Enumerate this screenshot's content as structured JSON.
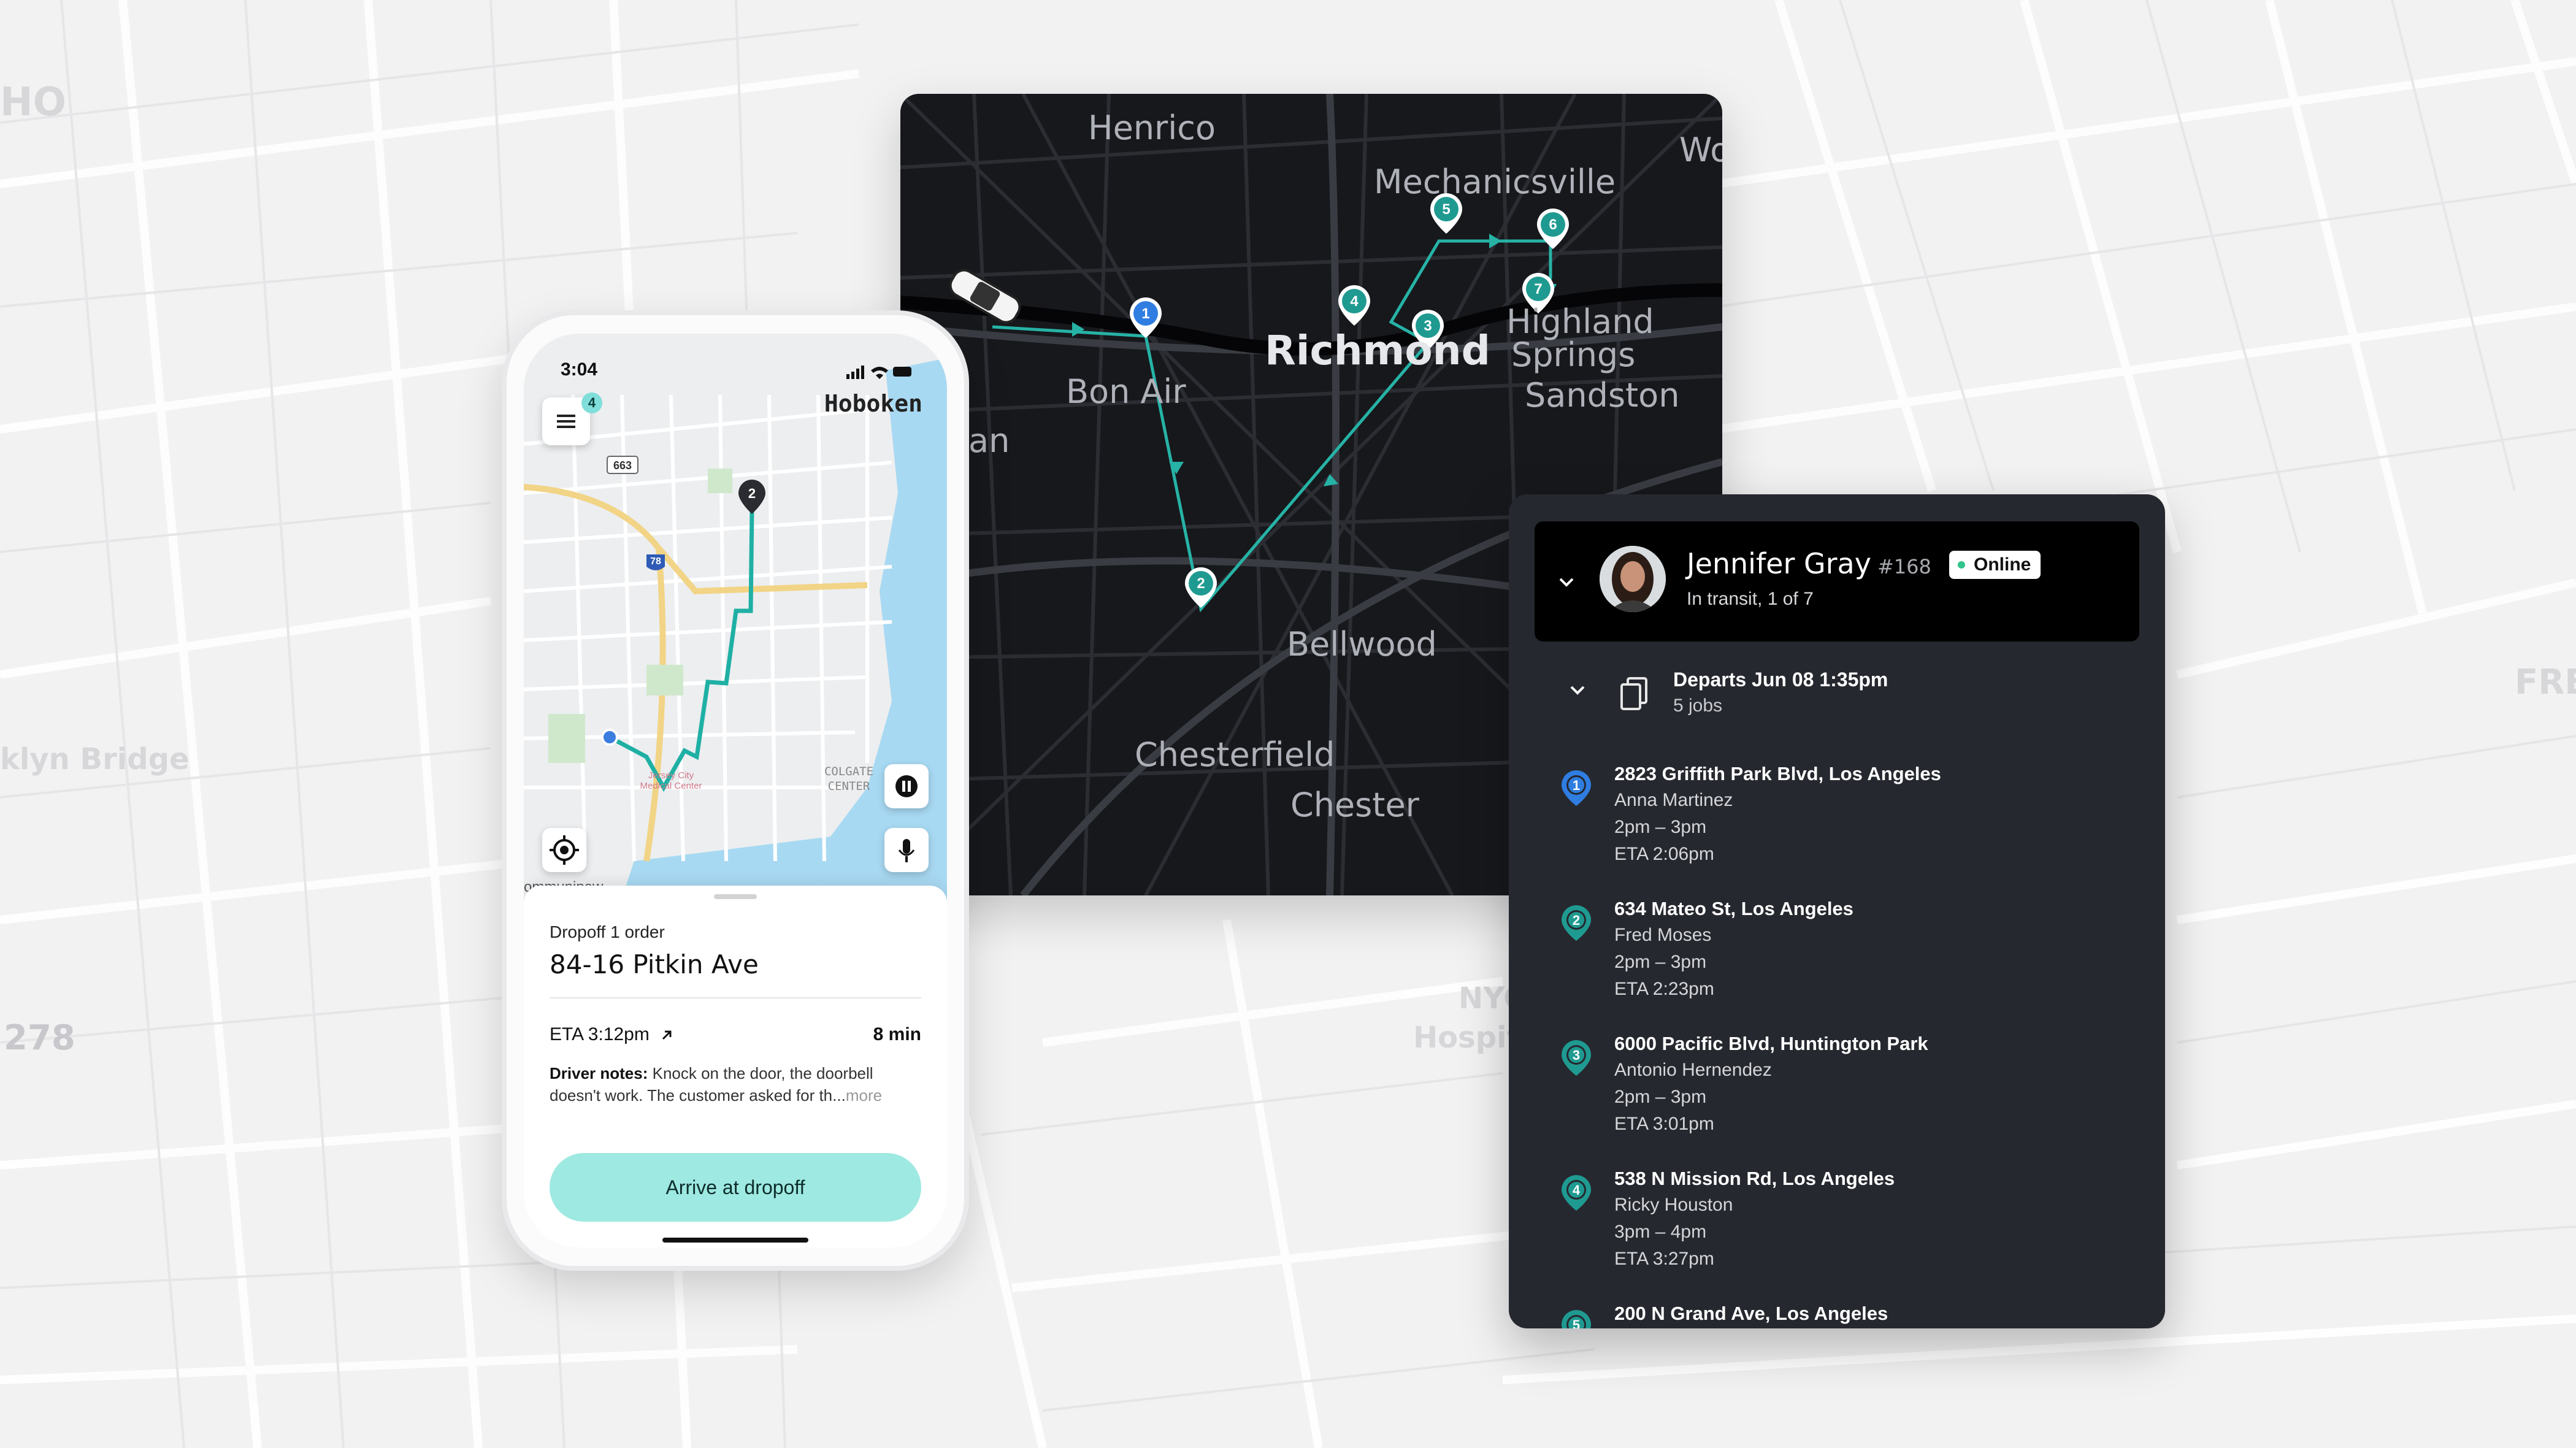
{
  "background": {
    "labels": [
      "HO",
      "klyn Bridge",
      "278",
      "FRE",
      "NYC",
      "Hospita"
    ]
  },
  "dark_map": {
    "labels": {
      "henrico": "Henrico",
      "mechanicsville": "Mechanicsville",
      "wo": "Wo",
      "richmond": "Richmond",
      "highland": "Highland",
      "springs": "Springs",
      "sandston": "Sandston",
      "bon_air": "Bon Air",
      "ian": "ian",
      "bellwood": "Bellwood",
      "chesterfield": "Chesterfield",
      "chester": "Chester"
    },
    "stops": [
      "1",
      "2",
      "3",
      "4",
      "5",
      "6",
      "7"
    ],
    "colors": {
      "route": "#26b3a6",
      "stop_active": "#2f7de1",
      "stop": "#1f9a91"
    }
  },
  "phone": {
    "time": "3:04",
    "city": "Hoboken",
    "menu_badge": "4",
    "map_labels": {
      "highway_663": "663",
      "highway_78": "78",
      "hospital": "Jersey City\nMedical Center",
      "colgate": "COLGATE\nCENTER",
      "communipaw": "ommunipaw",
      "stop_2": "2"
    },
    "sheet": {
      "subtitle": "Dropoff 1 order",
      "title": "84-16 Pitkin Ave",
      "eta": "ETA 3:12pm",
      "duration": "8 min",
      "notes_label": "Driver notes:",
      "notes_text": " Knock on the door, the doorbell doesn't work. The customer asked for th...",
      "notes_more": "more",
      "arrive_button": "Arrive at dropoff"
    }
  },
  "panel": {
    "driver_name": "Jennifer Gray",
    "driver_number": "#168",
    "online_label": "Online",
    "status": "In transit, 1 of 7",
    "departs": "Departs Jun 08 1:35pm",
    "jobs_count": "5 jobs",
    "stops": [
      {
        "num": "1",
        "address": "2823 Griffith Park Blvd, Los Angeles",
        "name": "Anna Martinez",
        "window": "2pm – 3pm",
        "eta": "ETA 2:06pm"
      },
      {
        "num": "2",
        "address": "634 Mateo St, Los Angeles",
        "name": "Fred Moses",
        "window": "2pm – 3pm",
        "eta": "ETA 2:23pm"
      },
      {
        "num": "3",
        "address": "6000 Pacific Blvd, Huntington Park",
        "name": "Antonio Hernendez",
        "window": "2pm – 3pm",
        "eta": "ETA 3:01pm"
      },
      {
        "num": "4",
        "address": "538 N Mission Rd, Los Angeles",
        "name": "Ricky Houston",
        "window": "3pm – 4pm",
        "eta": "ETA 3:27pm"
      },
      {
        "num": "5",
        "address": "200 N Grand Ave, Los Angeles",
        "name": "",
        "window": "",
        "eta": ""
      }
    ],
    "colors": {
      "stop_active": "#2f7de1",
      "stop": "#1f9a91"
    }
  }
}
